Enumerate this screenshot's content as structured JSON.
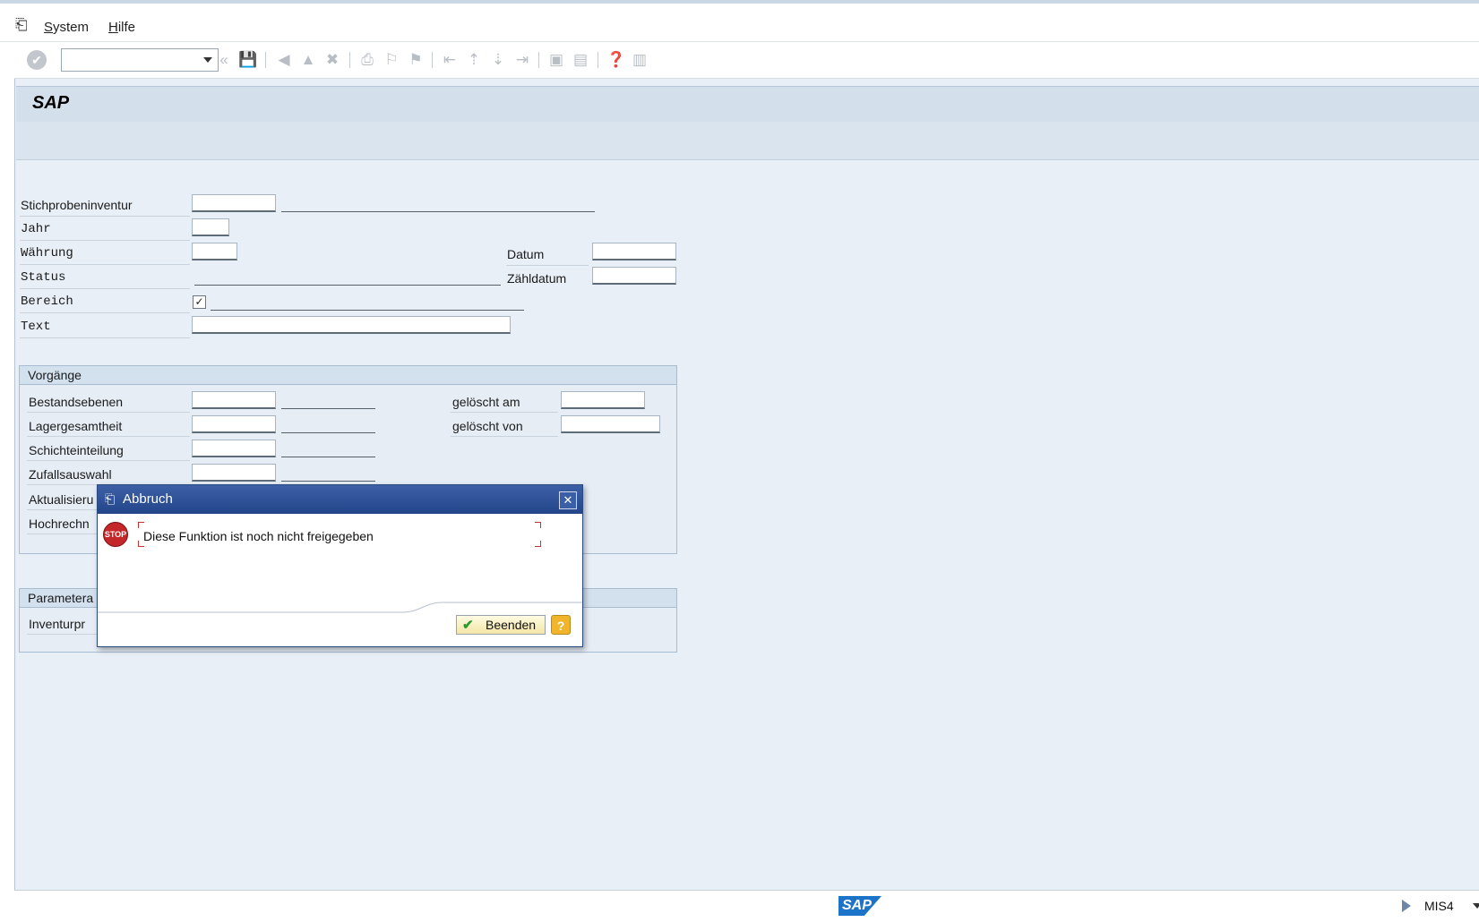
{
  "menu": {
    "items": [
      {
        "prefix": "S",
        "label": "ystem"
      },
      {
        "prefix": "H",
        "label": "ilfe"
      }
    ]
  },
  "screen": {
    "title": "SAP"
  },
  "form": {
    "stichprobeninventur_label": "Stichprobeninventur",
    "jahr_label": "Jahr",
    "waehrung_label": "Währung",
    "status_label": "Status",
    "bereich_label": "Bereich",
    "text_label": "Text",
    "datum_label": "Datum",
    "zaehldatum_label": "Zähldatum",
    "bereich_checked": true
  },
  "vorgaenge": {
    "title": "Vorgänge",
    "rows": [
      "Bestandsebenen",
      "Lagergesamtheit",
      "Schichteinteilung",
      "Zufallsauswahl",
      "Aktualisieru",
      "Hochrechn"
    ],
    "geloescht_am_label": "gelöscht am",
    "geloescht_von_label": "gelöscht von"
  },
  "parameter": {
    "title": "Parametera",
    "row_label": "Inventurpr"
  },
  "dialog": {
    "title": "Abbruch",
    "stop_text": "STOP",
    "message": "Diese Funktion ist noch nicht freigegeben",
    "button_label": "Beenden",
    "help_label": "?"
  },
  "status_bar": {
    "logo_text": "SAP",
    "system": "MIS4"
  },
  "colors": {
    "dialog_title": "#23468b",
    "stop_red": "#c3272a",
    "help_yellow": "#f2b42b",
    "sap_blue": "#1c74c8"
  }
}
